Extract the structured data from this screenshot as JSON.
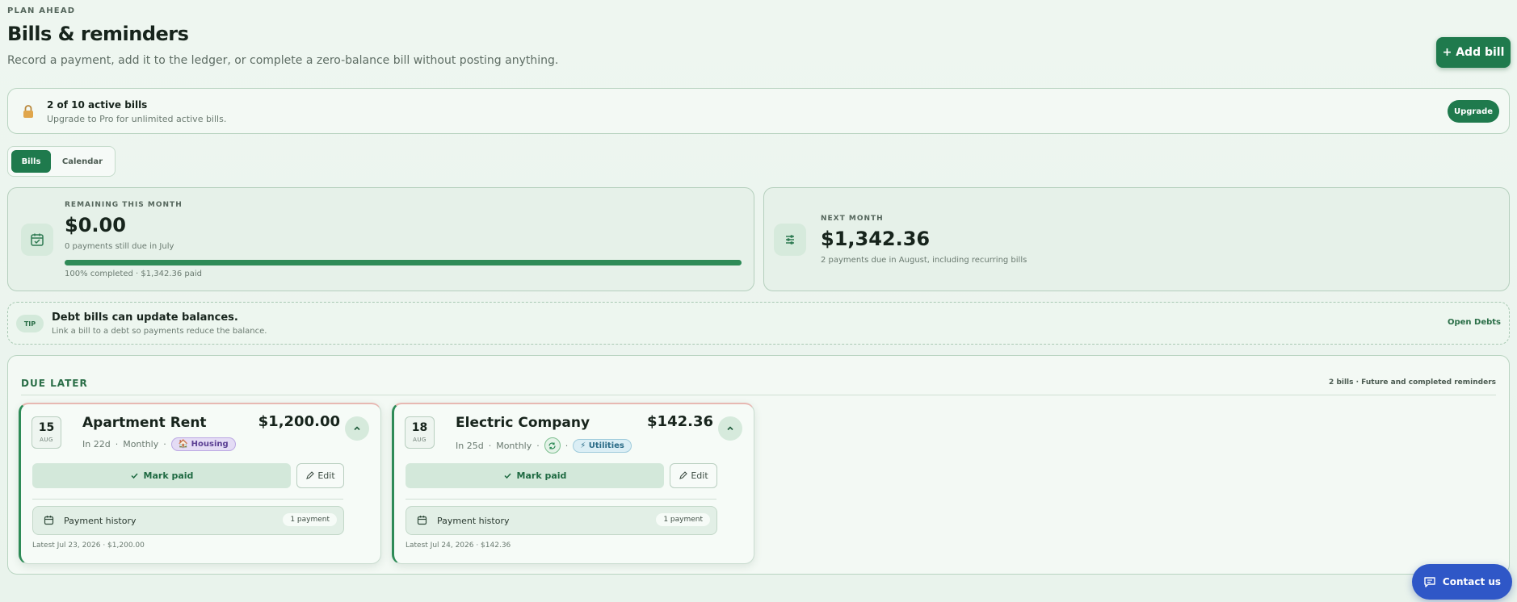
{
  "header": {
    "eyebrow": "PLAN AHEAD",
    "title": "Bills & reminders",
    "subtitle": "Record a payment, add it to the ledger, or complete a zero-balance bill without posting anything.",
    "add_bill_label": "+ Add bill"
  },
  "limit_banner": {
    "icon": "lock-icon",
    "title": "2 of 10 active bills",
    "subtitle": "Upgrade to Pro for unlimited active bills.",
    "upgrade_label": "Upgrade"
  },
  "tabs": [
    {
      "label": "Bills",
      "active": true
    },
    {
      "label": "Calendar",
      "active": false
    }
  ],
  "summary": {
    "remaining": {
      "label": "REMAINING THIS MONTH",
      "amount": "$0.00",
      "note": "0 payments still due in July",
      "progress_percent": 100,
      "progress_text": "100% completed · $1,342.36 paid"
    },
    "next_month": {
      "label": "NEXT MONTH",
      "amount": "$1,342.36",
      "note": "2 payments due in August, including recurring bills"
    }
  },
  "tip": {
    "pill": "TIP",
    "title": "Debt bills can update balances.",
    "subtitle": "Link a bill to a debt so payments reduce the balance.",
    "link_label": "Open Debts"
  },
  "due_later": {
    "title": "DUE LATER",
    "meta": "2 bills · Future and completed reminders",
    "bills": [
      {
        "day": "15",
        "month": "AUG",
        "name": "Apartment Rent",
        "amount": "$1,200.00",
        "due_in": "In 22d",
        "frequency": "Monthly",
        "category": "🏠 Housing",
        "mark_paid_label": "Mark paid",
        "edit_label": "Edit",
        "history_label": "Payment history",
        "history_count": "1 payment",
        "latest": "Latest Jul 23, 2026 · $1,200.00"
      },
      {
        "day": "18",
        "month": "AUG",
        "name": "Electric Company",
        "amount": "$142.36",
        "due_in": "In 25d",
        "frequency": "Monthly",
        "category": "⚡ Utilities",
        "mark_paid_label": "Mark paid",
        "edit_label": "Edit",
        "history_label": "Payment history",
        "history_count": "1 payment",
        "latest": "Latest Jul 24, 2026 · $142.36"
      }
    ]
  },
  "contact_label": "Contact us",
  "colors": {
    "accent": "#1f7a4d",
    "contact": "#2f57c7"
  }
}
